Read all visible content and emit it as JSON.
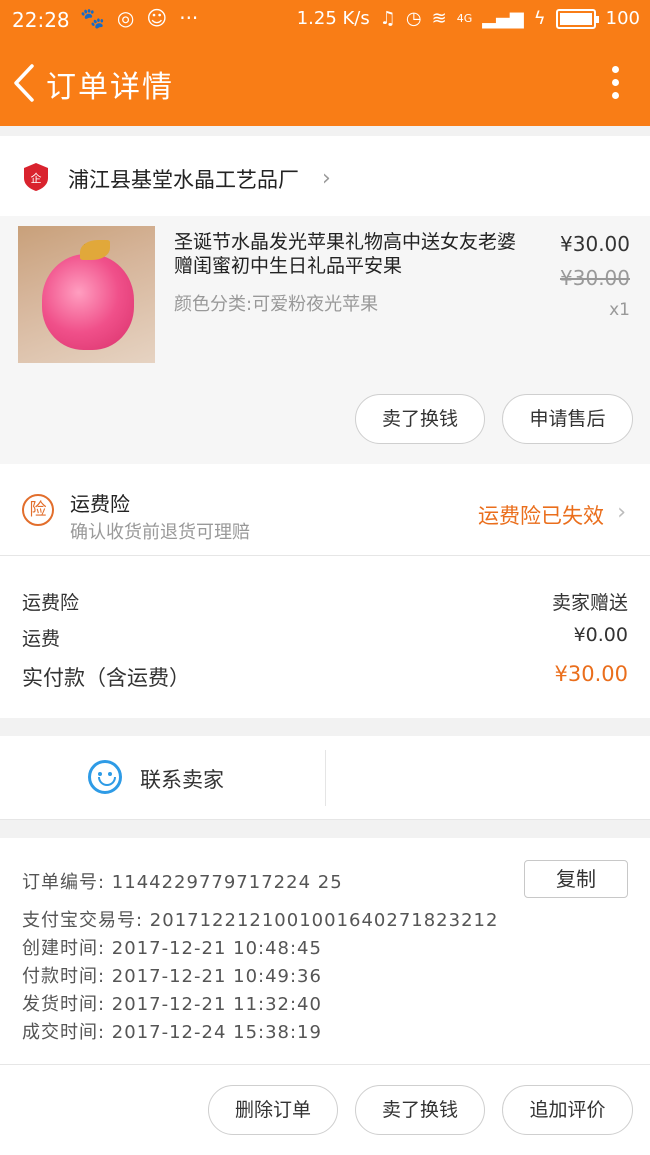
{
  "status_bar": {
    "time": "22:28",
    "net_speed": "1.25 K/s",
    "network": "4G",
    "battery": "100"
  },
  "header": {
    "title": "订单详情"
  },
  "shop": {
    "name": "浦江县基堂水晶工艺品厂"
  },
  "product": {
    "title": "圣诞节水晶发光苹果礼物高中送女友老婆赠闺蜜初中生日礼品平安果",
    "sku": "颜色分类:可爱粉夜光苹果",
    "price": "¥30.00",
    "original_price": "¥30.00",
    "quantity": "x1",
    "buttons": {
      "sell": "卖了换钱",
      "after_sale": "申请售后"
    }
  },
  "insurance": {
    "title": "运费险",
    "subtitle": "确认收货前退货可理赔",
    "status": "运费险已失效"
  },
  "fees": {
    "insurance_label": "运费险",
    "insurance_value": "卖家赠送",
    "shipping_label": "运费",
    "shipping_value": "¥0.00",
    "total_label": "实付款（含运费）",
    "total_value": "¥30.00"
  },
  "contact": {
    "label": "联系卖家"
  },
  "order_info": {
    "order_no": "订单编号:  1144229779717224 25",
    "copy_label": "复制",
    "alipay_no": "支付宝交易号:  2017122121001001640271823212",
    "created": "创建时间:  2017-12-21 10:48:45",
    "paid": "付款时间:  2017-12-21 10:49:36",
    "shipped": "发货时间:  2017-12-21 11:32:40",
    "completed": "成交时间:  2017-12-24 15:38:19"
  },
  "footer": {
    "delete": "删除订单",
    "sell": "卖了换钱",
    "review": "追加评价"
  },
  "colors": {
    "accent": "#f97d16",
    "price_orange": "#ea6e1c",
    "contact_blue": "#2e9be6"
  }
}
